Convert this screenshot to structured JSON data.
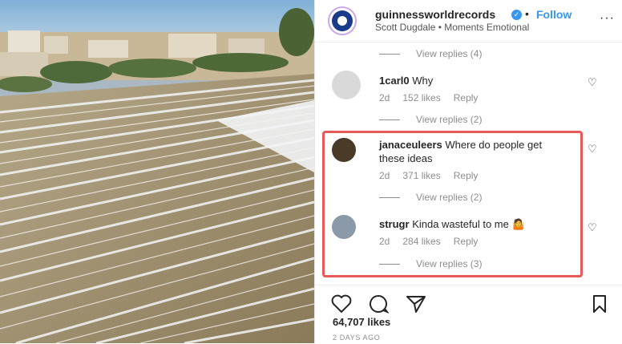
{
  "header": {
    "username": "guinnessworldrecords",
    "verified_icon": "verified-badge-icon",
    "separator": "•",
    "follow_label": "Follow",
    "subtitle": "Scott Dugdale • Moments Emotional",
    "more_icon": "more-options-icon",
    "more_glyph": "···"
  },
  "comments": [
    {
      "view_replies": "View replies (4)"
    },
    {
      "username": "1carl0",
      "text": "Why",
      "age": "2d",
      "likes": "152 likes",
      "reply": "Reply",
      "view_replies": "View replies (2)"
    },
    {
      "username": "janaceuleers",
      "text": "Where do people get these ideas",
      "age": "2d",
      "likes": "371 likes",
      "reply": "Reply",
      "view_replies": "View replies (2)"
    },
    {
      "username": "strugr",
      "text": "Kinda wasteful to me 🤷",
      "age": "2d",
      "likes": "284 likes",
      "reply": "Reply",
      "view_replies": "View replies (3)"
    }
  ],
  "heart_glyph": "♡",
  "actions": {
    "like_icon": "heart-icon",
    "comment_icon": "comment-icon",
    "share_icon": "share-icon",
    "save_icon": "bookmark-icon",
    "like_count": "64,707 likes",
    "posted": "2 DAYS AGO"
  },
  "colors": {
    "link": "#3897f0",
    "highlight": "#e85a5a"
  }
}
